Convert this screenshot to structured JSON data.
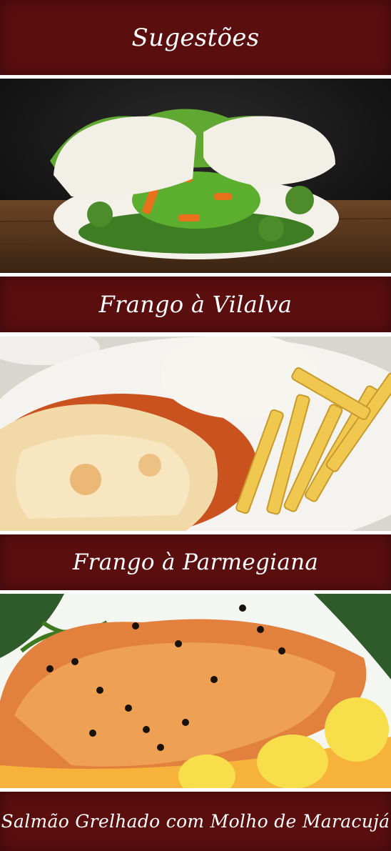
{
  "header": {
    "title": "Sugestões"
  },
  "dishes": [
    {
      "name": "Frango à Vilalva"
    },
    {
      "name": "Frango à Parmegiana"
    },
    {
      "name": "Salmão Grelhado com Molho de Maracujá"
    }
  ],
  "colors": {
    "banner": "#5a0e0e",
    "divider": "#ffffff",
    "text": "#ffffff"
  }
}
